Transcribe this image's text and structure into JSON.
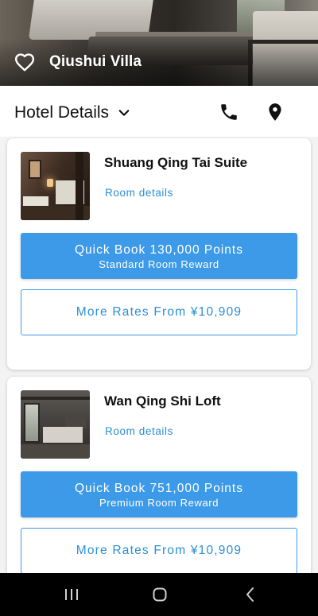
{
  "hotel": {
    "name": "Qiushui Villa",
    "favorite_icon": "heart-outline-icon"
  },
  "subheader": {
    "title": "Hotel Details",
    "dropdown_icon": "chevron-down-icon",
    "phone_icon": "phone-icon",
    "location_icon": "map-pin-icon"
  },
  "rooms": [
    {
      "name": "Shuang Qing Tai Suite",
      "details_link": "Room details",
      "quick_book": {
        "main": "Quick Book 130,000 Points",
        "sub": "Standard Room Reward"
      },
      "more_rates": "More Rates From ¥10,909"
    },
    {
      "name": "Wan Qing Shi Loft",
      "details_link": "Room details",
      "quick_book": {
        "main": "Quick Book 751,000 Points",
        "sub": "Premium Room Reward"
      },
      "more_rates": "More Rates From ¥10,909"
    }
  ],
  "theme": {
    "accent": "#3d9ae8",
    "link": "#2b8fd6",
    "background": "#f3f3f3"
  },
  "system_nav": {
    "recents_icon": "recents-icon",
    "home_icon": "home-icon",
    "back_icon": "back-icon"
  }
}
